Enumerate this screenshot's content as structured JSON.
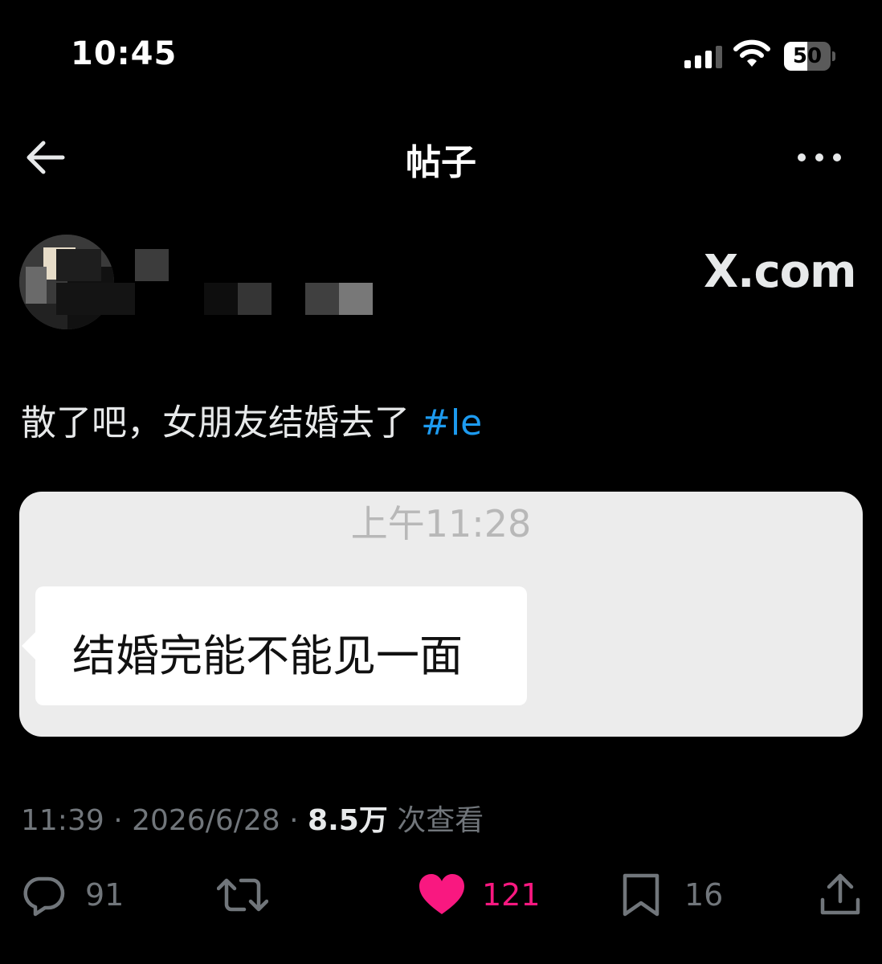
{
  "status_bar": {
    "time": "10:45",
    "battery": "50",
    "icons": [
      "cellular-signal-icon",
      "wifi-icon",
      "battery-icon"
    ]
  },
  "nav": {
    "title": "帖子",
    "icons": [
      "back-arrow-icon",
      "more-options-icon"
    ]
  },
  "watermark": "X.com",
  "post": {
    "text": "散了吧，女朋友结婚去了",
    "hashtag": "#le",
    "media": {
      "timestamp": "上午11:28",
      "message": "结婚完能不能见一面"
    },
    "meta": {
      "time": "11:39",
      "date": "2026/6/28",
      "views": "8.5万",
      "views_label": "次查看"
    },
    "actions": {
      "replies": "91",
      "reposts": "",
      "likes": "121",
      "bookmarks": "16"
    }
  },
  "colors": {
    "background": "#000000",
    "text": "#e7e9ea",
    "secondary_text": "#71767b",
    "hashtag": "#1d9bf0",
    "like": "#f91880"
  }
}
